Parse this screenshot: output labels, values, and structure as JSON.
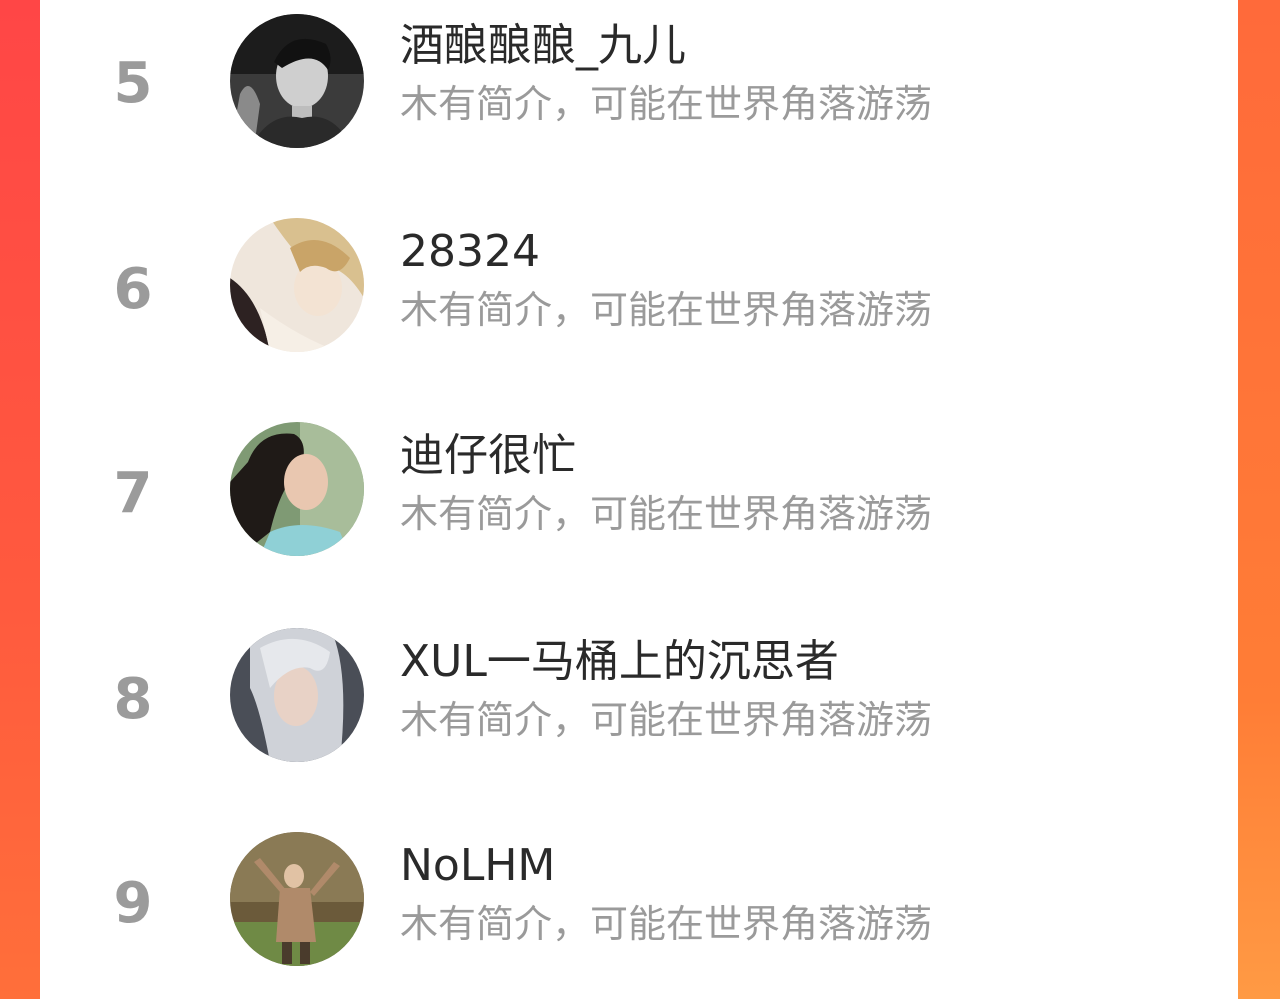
{
  "ranking": {
    "items": [
      {
        "rank": "5",
        "name": "酒酿酿酿_九儿",
        "intro": "木有简介，可能在世界角落游荡",
        "avatar_icon": "user-avatar-icon"
      },
      {
        "rank": "6",
        "name": "28324",
        "intro": "木有简介，可能在世界角落游荡",
        "avatar_icon": "user-avatar-icon"
      },
      {
        "rank": "7",
        "name": "迪仔很忙",
        "intro": "木有简介，可能在世界角落游荡",
        "avatar_icon": "user-avatar-icon"
      },
      {
        "rank": "8",
        "name": "XUL一马桶上的沉思者",
        "intro": "木有简介，可能在世界角落游荡",
        "avatar_icon": "user-avatar-icon"
      },
      {
        "rank": "9",
        "name": "NoLHM",
        "intro": "木有简介，可能在世界角落游荡",
        "avatar_icon": "user-avatar-icon"
      }
    ]
  },
  "colors": {
    "background_left": "#ff4646",
    "background_right": "#ff9640",
    "card": "#ffffff",
    "rank_text": "#9b9b9b",
    "name_text": "#2a2a2a",
    "intro_text": "#9a9a9a"
  }
}
